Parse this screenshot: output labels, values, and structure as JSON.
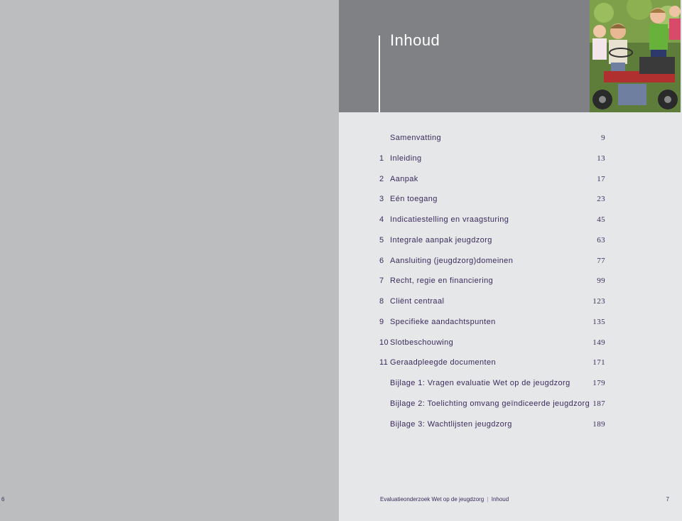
{
  "header": {
    "title": "Inhoud"
  },
  "toc": [
    {
      "num": "",
      "title": "Samenvatting",
      "page": "9"
    },
    {
      "num": "1",
      "title": "Inleiding",
      "page": "13"
    },
    {
      "num": "2",
      "title": "Aanpak",
      "page": "17"
    },
    {
      "num": "3",
      "title": "Eén toegang",
      "page": "23"
    },
    {
      "num": "4",
      "title": "Indicatiestelling en vraagsturing",
      "page": "45"
    },
    {
      "num": "5",
      "title": "Integrale aanpak jeugdzorg",
      "page": "63"
    },
    {
      "num": "6",
      "title": "Aansluiting (jeugdzorg)domeinen",
      "page": "77"
    },
    {
      "num": "7",
      "title": "Recht, regie en financiering",
      "page": "99"
    },
    {
      "num": "8",
      "title": "Cliënt centraal",
      "page": "123"
    },
    {
      "num": "9",
      "title": "Specifieke aandachtspunten",
      "page": "135"
    },
    {
      "num": "10",
      "title": "Slotbeschouwing",
      "page": "149"
    },
    {
      "num": "11",
      "title": "Geraadpleegde documenten",
      "page": "171"
    },
    {
      "num": "",
      "title": "Bijlage 1:  Vragen evaluatie Wet op de jeugdzorg",
      "page": "179"
    },
    {
      "num": "",
      "title": "Bijlage 2: Toelichting omvang geïndiceerde jeugdzorg",
      "page": "187"
    },
    {
      "num": "",
      "title": "Bijlage 3: Wachtlijsten jeugdzorg",
      "page": "189"
    }
  ],
  "footer": {
    "left_page_number": "6",
    "running_title": "Evaluatieonderzoek Wet op de jeugdzorg",
    "separator": "|",
    "section": "Inhoud",
    "right_page_number": "7"
  },
  "colors": {
    "text": "#3b2a5c",
    "left_page": "#bcbdbf",
    "right_page": "#e6e7e8",
    "header_band": "#808184"
  },
  "images": {
    "header_photo": "children-on-go-kart-photo"
  }
}
